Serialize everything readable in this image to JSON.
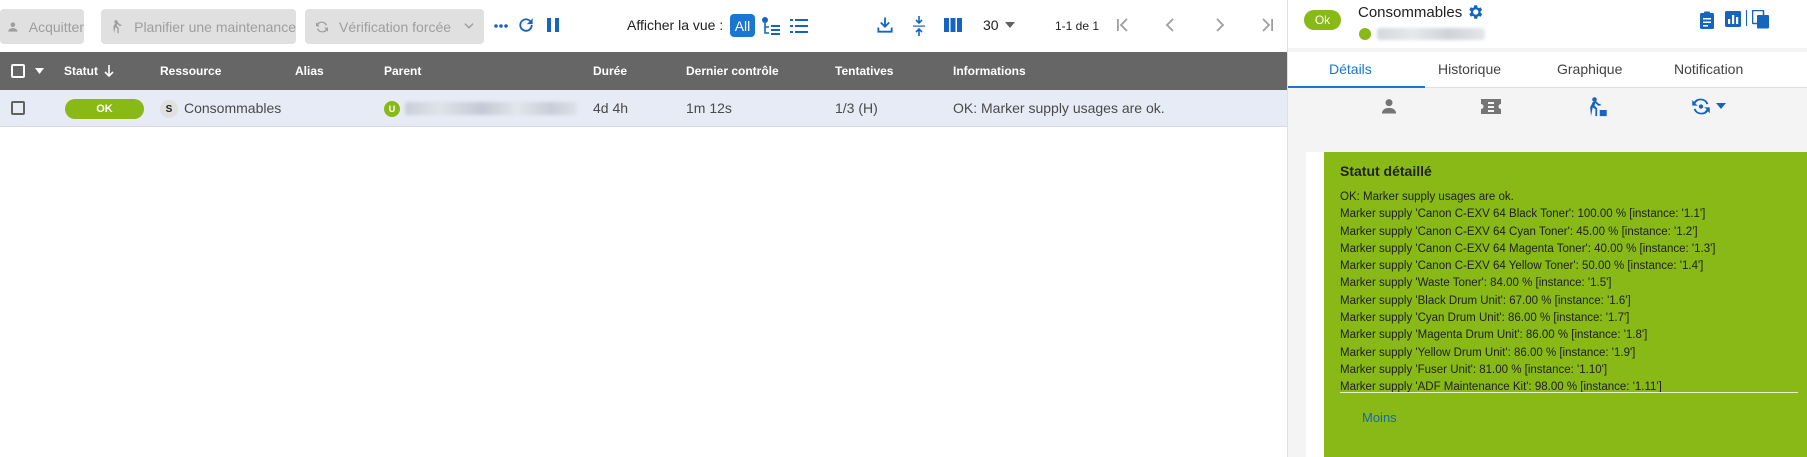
{
  "toolbar": {
    "acknowledge_label": "Acquitter",
    "downtime_label": "Planifier une maintenance",
    "forced_check_label": "Vérification forcée",
    "view_label": "Afficher la vue :",
    "view_all_label": "All",
    "per_page": "30",
    "pagination_text": "1-1 de 1"
  },
  "table": {
    "columns": [
      "Statut",
      "Ressource",
      "Alias",
      "Parent",
      "Durée",
      "Dernier contrôle",
      "Tentatives",
      "Informations"
    ],
    "rows": [
      {
        "status": "OK",
        "resource_badge": "S",
        "resource": "Consommables",
        "alias": "",
        "parent_badge": "U",
        "duration": "4d 4h",
        "last_check": "1m 12s",
        "tries": "1/3 (H)",
        "information": "OK: Marker supply usages are ok."
      }
    ]
  },
  "panel": {
    "status_chip": "Ok",
    "title": "Consommables",
    "tabs": [
      "Détails",
      "Historique",
      "Graphique",
      "Notification"
    ],
    "active_tab": "Détails",
    "detail_title": "Statut détaillé",
    "detail_lines": [
      "OK: Marker supply usages are ok.",
      "Marker supply 'Canon C-EXV 64 Black Toner': 100.00 % [instance: '1.1']",
      "Marker supply 'Canon C-EXV 64 Cyan Toner': 45.00 % [instance: '1.2']",
      "Marker supply 'Canon C-EXV 64 Magenta Toner': 40.00 % [instance: '1.3']",
      "Marker supply 'Canon C-EXV 64 Yellow Toner': 50.00 % [instance: '1.4']",
      "Marker supply 'Waste Toner': 84.00 % [instance: '1.5']",
      "Marker supply 'Black Drum Unit': 67.00 % [instance: '1.6']",
      "Marker supply 'Cyan Drum Unit': 86.00 % [instance: '1.7']",
      "Marker supply 'Magenta Drum Unit': 86.00 % [instance: '1.8']",
      "Marker supply 'Yellow Drum Unit': 86.00 % [instance: '1.9']",
      "Marker supply 'Fuser Unit': 81.00 % [instance: '1.10']",
      "Marker supply 'ADF Maintenance Kit': 98.00 % [instance: '1.11']"
    ],
    "less_label": "Moins"
  },
  "colors": {
    "ok_green": "#88b917",
    "primary_blue": "#1976d2",
    "table_header": "#666666",
    "row_selected": "#e6ebf5"
  }
}
